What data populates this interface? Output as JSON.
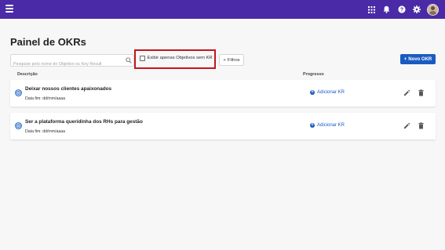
{
  "header": {
    "icons": [
      "menu-icon",
      "apps-grid-icon",
      "bell-icon",
      "help-icon",
      "gear-icon",
      "avatar"
    ],
    "color": "#4a2aa6"
  },
  "page": {
    "title": "Painel de OKRs"
  },
  "toolbar": {
    "search_placeholder": "Pesquise pelo nome do Objetivo ou Key Result",
    "checkbox_label": "Exibir apenas Objetivos sem KR",
    "checkbox_checked": false,
    "filters_label": "Filtros",
    "new_okr_label": "Novo OKR"
  },
  "columns": {
    "description": "Descrição",
    "progress": "Progresso"
  },
  "objectives": [
    {
      "title": "Deixar nossos clientes apaixonados",
      "date_label": "Data fim: dd/mm/aaaa",
      "add_kr_label": "Adicionar KR"
    },
    {
      "title": "Ser a plataforma queridinha dos RHs para gestão",
      "date_label": "Data fim: dd/mm/aaaa",
      "add_kr_label": "Adicionar KR"
    }
  ],
  "colors": {
    "accent": "#1a5bc2",
    "highlight_border": "#c3161e"
  }
}
